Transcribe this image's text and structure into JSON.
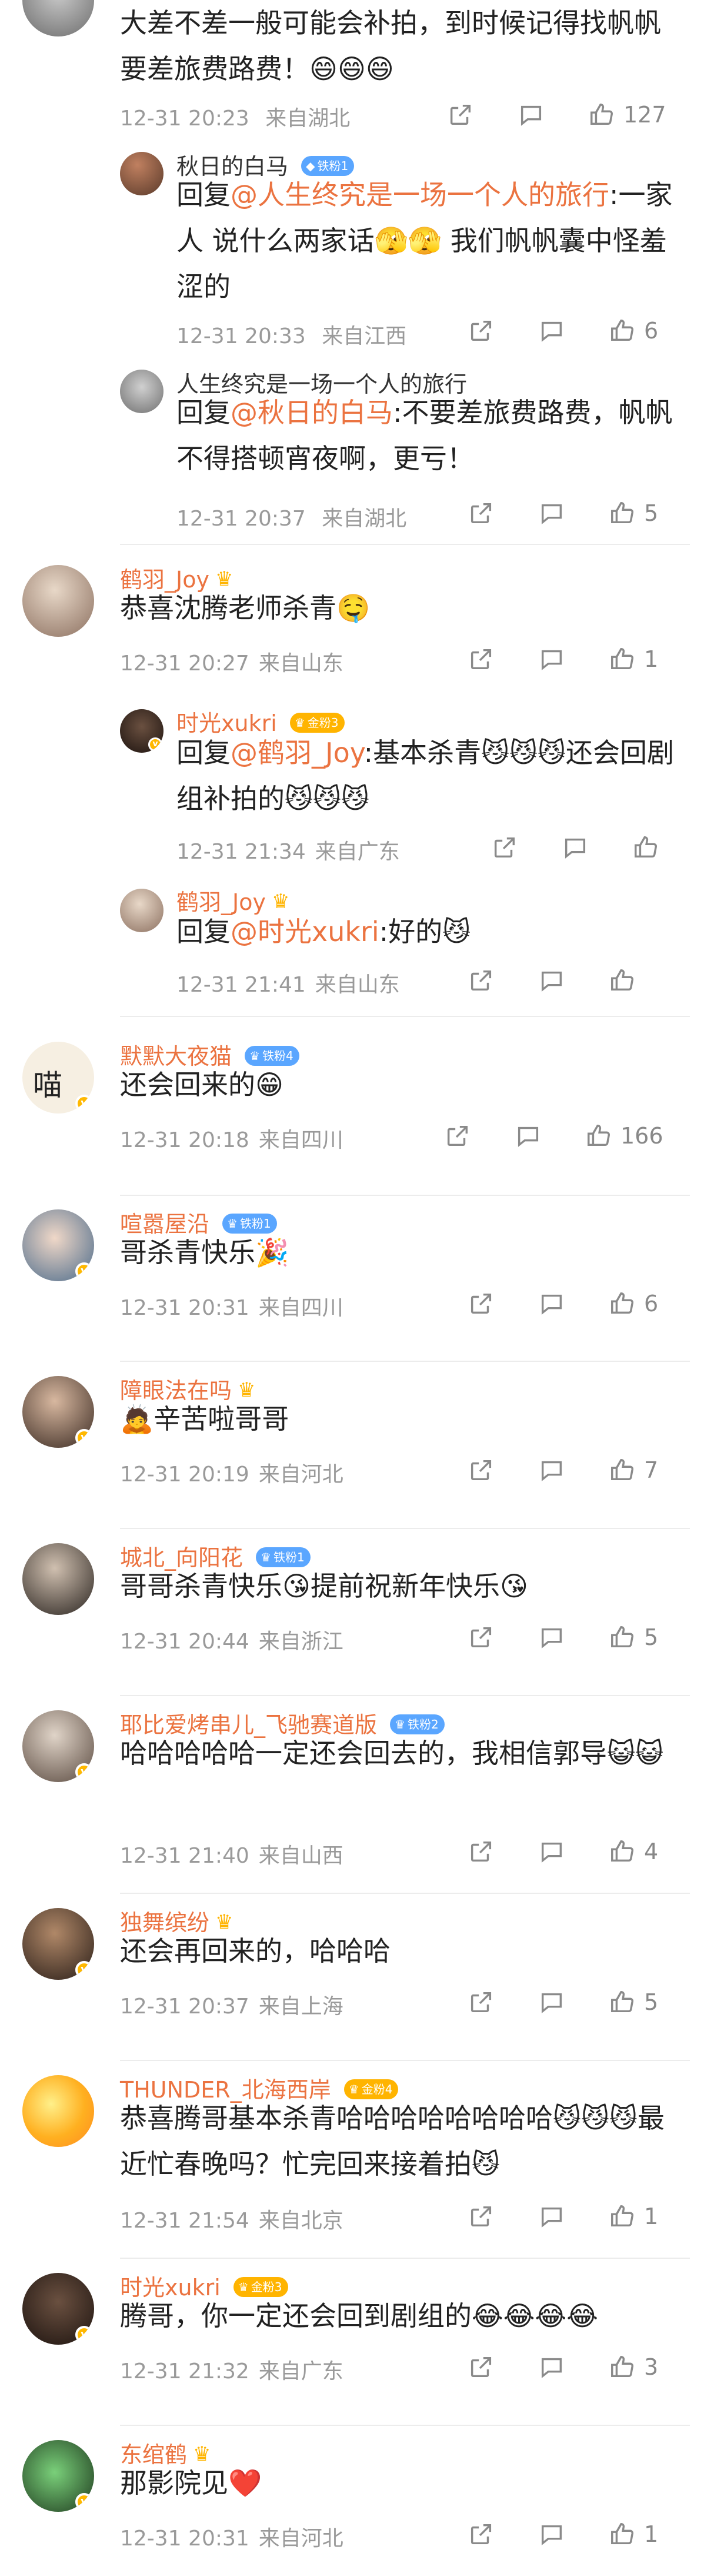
{
  "comments": [
    {
      "text": "大差不差一般可能会补拍，到时候记得找帆帆要差旅费路费！😄😄😄",
      "time": "12-31 20:23",
      "loc": "来自湖北",
      "likes": "127",
      "replies": [
        {
          "name": "秋日的白马",
          "badge": "铁粉1",
          "prefix": "回复",
          "at": "@人生终究是一场一个人的旅行",
          "text": ":一家人 说什么两家话🫣🫣 我们帆帆囊中怪羞涩的",
          "time": "12-31 20:33",
          "loc": "来自江西",
          "likes": "6"
        },
        {
          "name": "人生终究是一场一个人的旅行",
          "prefix": "回复",
          "at": "@秋日的白马",
          "text": ":不要差旅费路费，帆帆不得搭顿宵夜啊，更亏！",
          "time": "12-31 20:37",
          "loc": "来自湖北",
          "likes": "5"
        }
      ]
    },
    {
      "name": "鹤羽_Joy",
      "text": "恭喜沈腾老师杀青🤤",
      "time": "12-31 20:27",
      "loc": "来自山东",
      "likes": "1",
      "replies": [
        {
          "name": "时光xukri",
          "badge": "金粉3",
          "prefix": "回复",
          "at": "@鹤羽_Joy",
          "text": ":基本杀青😼😼😼还会回剧组补拍的😼😼😼",
          "time": "12-31 21:34",
          "loc": "来自广东",
          "likes": ""
        },
        {
          "name": "鹤羽_Joy",
          "prefix": "回复",
          "at": "@时光xukri",
          "text": ":好的😼",
          "time": "12-31 21:41",
          "loc": "来自山东",
          "likes": ""
        }
      ]
    },
    {
      "name": "默默大夜猫",
      "badge": "铁粉4",
      "text": "还会回来的😁",
      "time": "12-31 20:18",
      "loc": "来自四川",
      "likes": "166"
    },
    {
      "name": "喧嚣屋沿",
      "badge": "铁粉1",
      "text": "哥杀青快乐🎉",
      "time": "12-31 20:31",
      "loc": "来自四川",
      "likes": "6"
    },
    {
      "name": "障眼法在吗",
      "text": "🙇辛苦啦哥哥",
      "time": "12-31 20:19",
      "loc": "来自河北",
      "likes": "7"
    },
    {
      "name": "城北_向阳花",
      "badge": "铁粉1",
      "text": "哥哥杀青快乐😘提前祝新年快乐😘",
      "time": "12-31 20:44",
      "loc": "来自浙江",
      "likes": "5"
    },
    {
      "name": "耶比爱烤串儿_飞驰赛道版",
      "badge": "铁粉2",
      "text": "哈哈哈哈哈一定还会回去的，我相信郭导😺😺",
      "time": "12-31 21:40",
      "loc": "来自山西",
      "likes": "4"
    },
    {
      "name": "独舞缤纷",
      "text": "还会再回来的，哈哈哈",
      "time": "12-31 20:37",
      "loc": "来自上海",
      "likes": "5"
    },
    {
      "name": "THUNDER_北海西岸",
      "badge": "金粉4",
      "text": "恭喜腾哥基本杀青哈哈哈哈哈哈哈哈😼😼😼最近忙春晚吗？忙完回来接着拍😼",
      "time": "12-31 21:54",
      "loc": "来自北京",
      "likes": "1"
    },
    {
      "name": "时光xukri",
      "badge": "金粉3",
      "text": "腾哥，你一定还会回到剧组的😂😂😂😂",
      "time": "12-31 21:32",
      "loc": "来自广东",
      "likes": "3"
    },
    {
      "name": "东绾鹤",
      "text": "那影院见❤️",
      "time": "12-31 20:31",
      "loc": "来自河北",
      "likes": "1"
    }
  ],
  "icons": {
    "share": "share-icon",
    "comment": "comment-icon",
    "like": "thumbs-up-icon"
  },
  "colors": {
    "name": "#eb7340",
    "meta": "#9a9a9a",
    "iron_badge": "#5aa6ff",
    "gold_badge": "#ffb400"
  }
}
